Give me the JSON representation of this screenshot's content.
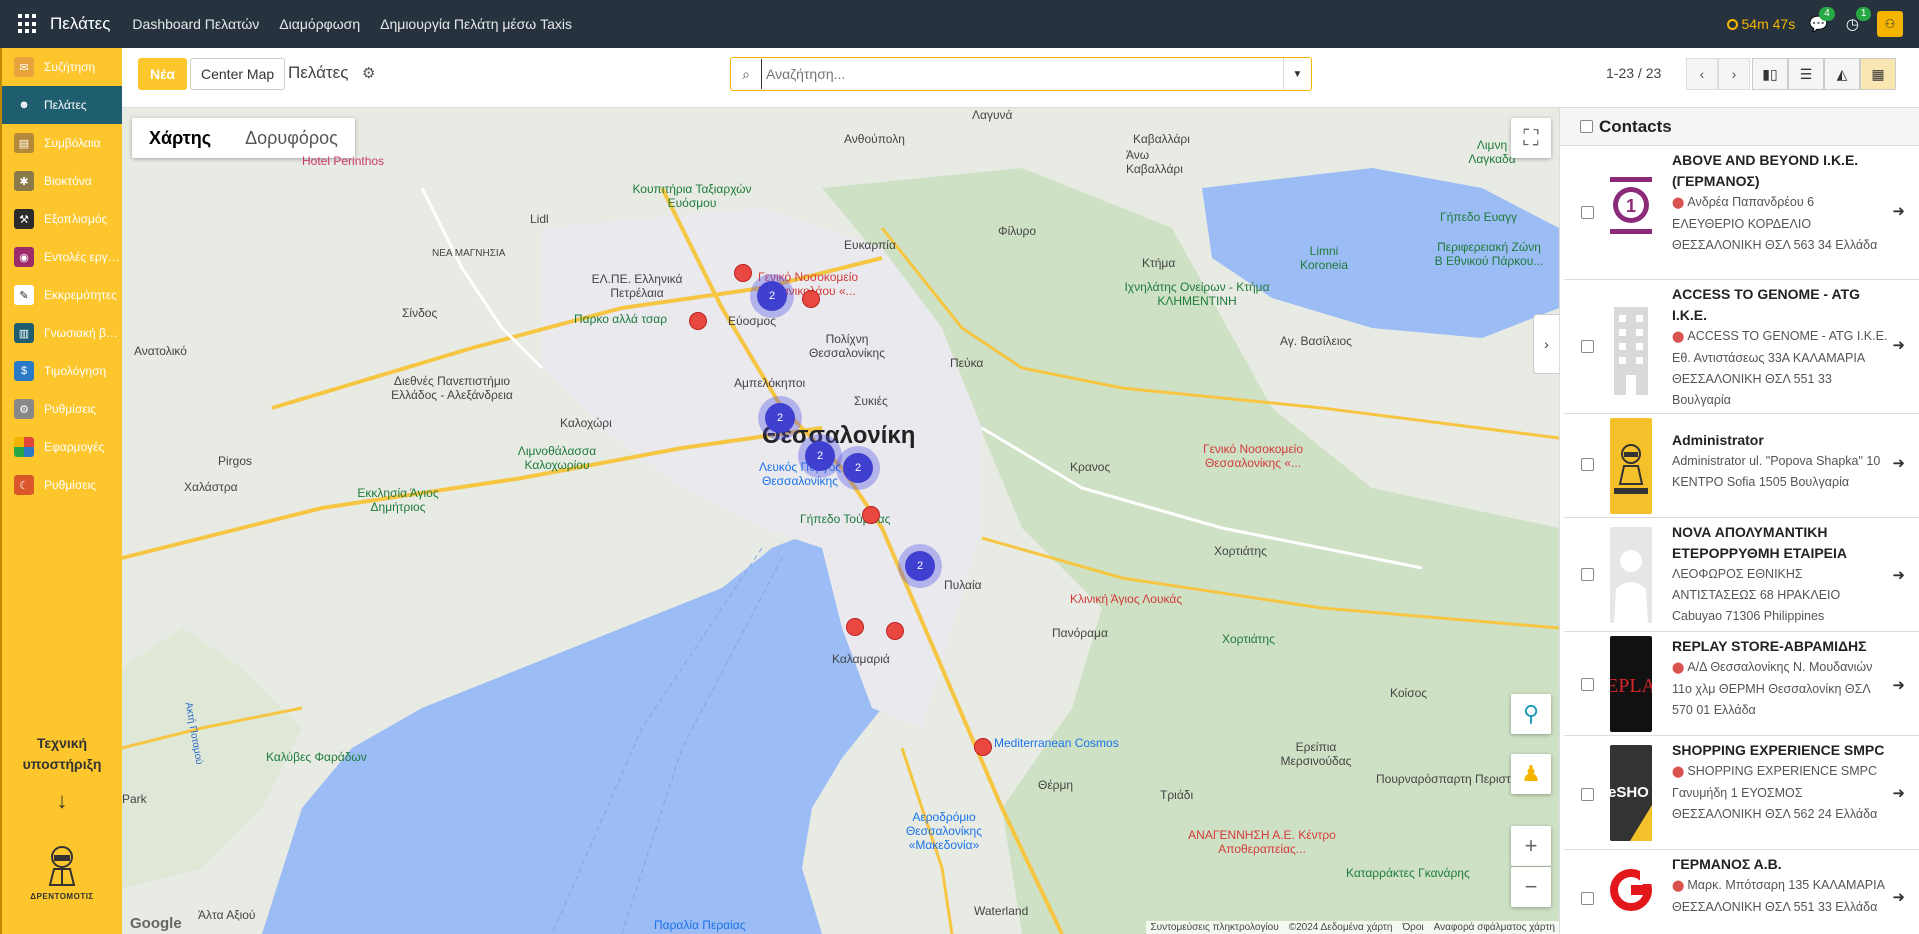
{
  "topbar": {
    "app_name": "Πελάτες",
    "menu": [
      "Dashboard Πελατών",
      "Διαμόρφωση",
      "Δημιουργία Πελάτη μέσω Taxis"
    ],
    "timer": "54m 47s",
    "messages_count": "4",
    "activities_count": "1"
  },
  "sidebar": {
    "items": [
      {
        "label": "Συζήτηση",
        "icon": "chat-icon",
        "color": "#e8a33d"
      },
      {
        "label": "Πελάτες",
        "icon": "users-icon",
        "color": "#1f5e6e",
        "active": true
      },
      {
        "label": "Συμβόλαια",
        "icon": "contract-icon",
        "color": "#b48a3a"
      },
      {
        "label": "Βιοκτόνα",
        "icon": "biocide-icon",
        "color": "#8a7a4a"
      },
      {
        "label": "Εξοπλισμός",
        "icon": "equipment-icon",
        "color": "#2b2b2b"
      },
      {
        "label": "Εντολές εργασίας",
        "icon": "work-order-icon",
        "color": "#9b2b6b"
      },
      {
        "label": "Εκκρεμότητες",
        "icon": "pending-icon",
        "color": "#222"
      },
      {
        "label": "Γνωσιακή βάση",
        "icon": "knowledge-icon",
        "color": "#1f5e6e"
      },
      {
        "label": "Τιμολόγηση",
        "icon": "invoice-icon",
        "color": "#2a7ac8"
      },
      {
        "label": "Ρυθμίσεις",
        "icon": "settings-icon",
        "color": "#555"
      },
      {
        "label": "Εφαρμογές",
        "icon": "apps-icon",
        "color": "#e0463a"
      },
      {
        "label": "Ρυθμίσεις",
        "icon": "settings-alt-icon",
        "color": "#d9572b"
      }
    ],
    "support_label": "Τεχνική υποστήριξη",
    "support_arrow": "↓",
    "logo_text": "ΔΡΕΝΤΟΜΟΤΙΣ"
  },
  "control": {
    "new_button": "Νέα",
    "center_button": "Center Map",
    "title": "Πελάτες",
    "search_placeholder": "Αναζήτηση...",
    "pager": "1-23 / 23"
  },
  "map": {
    "type_map": "Χάρτης",
    "type_satellite": "Δορυφόρος",
    "city": "Θεσσαλονίκη",
    "labels": [
      {
        "t": "Λαγυνά"
      },
      {
        "t": "Ανθούπολη"
      },
      {
        "t": "Καβαλλάρι"
      },
      {
        "t": "Άνω Καβαλλάρι"
      },
      {
        "t": "Κουπιτήρια Ταξιαρχών Ευόσμου"
      },
      {
        "t": "Hotel Perinthos"
      },
      {
        "t": "ΝΕΑ ΜΑΓΝΗΣΙΑ"
      },
      {
        "t": "Ευκαρπία"
      },
      {
        "t": "ΕΛ.ΠΕ. Ελληνικά Πετρέλαια"
      },
      {
        "t": "Γενικό Νοσοκομείο Παπανικολάου «..."
      },
      {
        "t": "Σίνδος"
      },
      {
        "t": "Παρκο αλλά τσαρ"
      },
      {
        "t": "Εύοσμος"
      },
      {
        "t": "Πολίχνη Θεσσαλονίκης"
      },
      {
        "t": "Πεύκα"
      },
      {
        "t": "Φίλυρο"
      },
      {
        "t": "Κτήμα"
      },
      {
        "t": "Ιχνηλάτης Ονείρων - Κτήμα ΚΛΗΜΕΝΤΙΝΗ"
      },
      {
        "t": "Limni Koroneia"
      },
      {
        "t": "Αγ. Βασίλειος"
      },
      {
        "t": "Ανατολικό"
      },
      {
        "t": "Διεθνές Πανεπιστήμιο Ελλάδος - Αλεξάνδρεια"
      },
      {
        "t": "Αμπελόκηποι"
      },
      {
        "t": "Συκιές"
      },
      {
        "t": "Καλοχώρι"
      },
      {
        "t": "Pirgos"
      },
      {
        "t": "Χαλάστρα"
      },
      {
        "t": "Λιμνοθάλασσα Καλοχωρίου"
      },
      {
        "t": "Εκκλησία Άγιος Δημήτριος"
      },
      {
        "t": "Λευκός Πύργος Θεσσαλονίκης"
      },
      {
        "t": "Γενικό Νοσοκομείο Θεσσαλονίκης «..."
      },
      {
        "t": "Κρανος"
      },
      {
        "t": "Χορτιάτης"
      },
      {
        "t": "Πυλαία"
      },
      {
        "t": "Κλινική Άγιος Λουκάς"
      },
      {
        "t": "Πανόραμα"
      },
      {
        "t": "Χορτιάτης"
      },
      {
        "t": "Καλαμαριά"
      },
      {
        "t": "Κοίσος"
      },
      {
        "t": "Καλύβες Φαράδων"
      },
      {
        "t": "Mediterranean Cosmos"
      },
      {
        "t": "Θέρμη"
      },
      {
        "t": "Τριάδι"
      },
      {
        "t": "Ερείπια Μερσινούδας"
      },
      {
        "t": "Πουρναρόσπαρτη Περιστέρι"
      },
      {
        "t": "Αεροδρόμιο Θεσσαλονίκης «Μακεδονία»"
      },
      {
        "t": "ΑΝΑΓΕΝΝΗΣΗ Α.Ε. Κέντρο Αποθεραπείας..."
      },
      {
        "t": "Καταρράκτες Γκανάρης"
      },
      {
        "t": "Waterland"
      },
      {
        "t": "Άλτα Αξιού"
      },
      {
        "t": "Παραλία Περαίας"
      },
      {
        "t": "Γήπεδο Τούμπας"
      },
      {
        "t": "Γήπεδο Ευαγγ"
      },
      {
        "t": "Περιφερειακή Ζώνη Β Εθνικού Πάρκου..."
      },
      {
        "t": "Λιμνη Λαγκαδά"
      },
      {
        "t": "Ακτή Ποταμού"
      },
      {
        "t": "Lidl"
      },
      {
        "t": "Park"
      }
    ],
    "clusters": [
      "2",
      "2",
      "2",
      "2",
      "2"
    ],
    "attribution": [
      "Συντομεύσεις πληκτρολογίου",
      "©2024 Δεδομένα χάρτη",
      "Όροι",
      "Αναφορά σφάλματος χάρτη"
    ],
    "google": "Google",
    "toggle": "›"
  },
  "panel": {
    "title": "Contacts",
    "contacts": [
      {
        "name": "ABOVE AND BEYOND I.K.E. (ΓΕΡΜΑΝΟΣ)",
        "address": "Ανδρέα Παπανδρέου 6 ΕΛΕΥΘΕΡΙΟ ΚΟΡΔΕΛΙΟ ΘΕΣΣΑΛΟΝΙΚΗ ΘΣΛ 563 34 Ελλάδα",
        "pin": true,
        "image": "number-one-logo"
      },
      {
        "name": "ACCESS TO GENOME - ATG I.K.E.",
        "address": "ACCESS TO GENOME - ATG I.K.E. Εθ. Αντιστάσεως 33Α ΚΑΛΑΜΑΡΙΑ ΘΕΣΣΑΛΟΝΙΚΗ ΘΣΛ 551 33 Βουλγαρία",
        "pin": true,
        "image": "building-placeholder"
      },
      {
        "name": "Administrator",
        "address": "Administrator ul. \"Popova Shapka\" 10 ΚΕΝΤΡΟ Sofia 1505 Βουλγαρία",
        "pin": false,
        "image": "company-logo"
      },
      {
        "name": "NOVA ΑΠΟΛΥΜΑΝΤΙΚΗ ΕΤΕΡΟΡΡΥΘΜΗ ΕΤΑΙΡΕΙΑ",
        "address": "ΛΕΟΦΩΡΟΣ ΕΘΝΙΚΗΣ ΑΝΤΙΣΤΑΣΕΩΣ 68 ΗΡΑΚΛΕΙΟ Cabuyao 71306 Philippines",
        "pin": false,
        "image": "person-placeholder"
      },
      {
        "name": "REPLAY STORE-ΑΒΡΑΜΙΔΗΣ",
        "address": "Α/Δ Θεσσαλονίκης Ν. Μουδανιών 11ο χλμ ΘΕΡΜΗ Θεσσαλονίκη ΘΣΛ 570 01 Ελλάδα",
        "pin": true,
        "image": "replay-logo"
      },
      {
        "name": "SHOPPING EXPERIENCE SMPC",
        "address": "SHOPPING EXPERIENCE SMPC Γανυμήδη 1 ΕΥΟΣΜΟΣ ΘΕΣΣΑΛΟΝΙΚΗ ΘΣΛ 562 24 Ελλάδα",
        "pin": true,
        "image": "shop-logo"
      },
      {
        "name": "ΓΕΡΜΑΝΟΣ Α.Β.",
        "address": "Μαρκ. Μπότσαρη 135 ΚΑΛΑΜΑΡΙΑ ΘΕΣΣΑΛΟΝΙΚΗ ΘΣΛ 551 33 Ελλάδα",
        "pin": true,
        "image": "germanos-logo"
      }
    ]
  }
}
